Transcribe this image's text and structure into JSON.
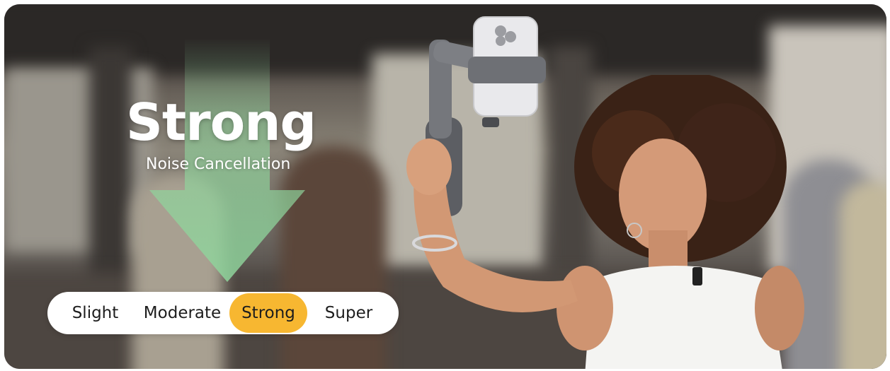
{
  "banner": {
    "headline": "Strong",
    "subheadline": "Noise Cancellation",
    "arrow_color": "#8fd59c",
    "accent_color": "#f7b731"
  },
  "noise_levels": {
    "options": [
      "Slight",
      "Moderate",
      "Strong",
      "Super"
    ],
    "selected": "Strong"
  },
  "icons": {
    "arrow": "down-arrow-icon"
  }
}
